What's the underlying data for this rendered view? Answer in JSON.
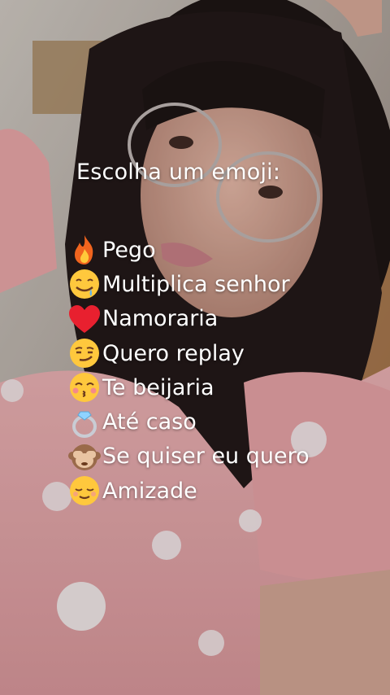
{
  "prompt": "Escolha um emoji:",
  "options": [
    {
      "emoji": "fire-icon",
      "label": "Pego"
    },
    {
      "emoji": "drooling-face-icon",
      "label": "Multiplica senhor"
    },
    {
      "emoji": "red-heart-icon",
      "label": "Namoraria"
    },
    {
      "emoji": "smirking-face-icon",
      "label": "Quero replay"
    },
    {
      "emoji": "kissing-face-icon",
      "label": "Te beijaria"
    },
    {
      "emoji": "ring-icon",
      "label": "Até caso"
    },
    {
      "emoji": "see-no-evil-monkey-icon",
      "label": "Se quiser eu quero"
    },
    {
      "emoji": "relieved-face-icon",
      "label": "Amizade"
    }
  ],
  "colors": {
    "text": "#ffffff",
    "dress": "#e7a3a6",
    "hair": "#1b1413",
    "skin": "#d9ab9a"
  }
}
